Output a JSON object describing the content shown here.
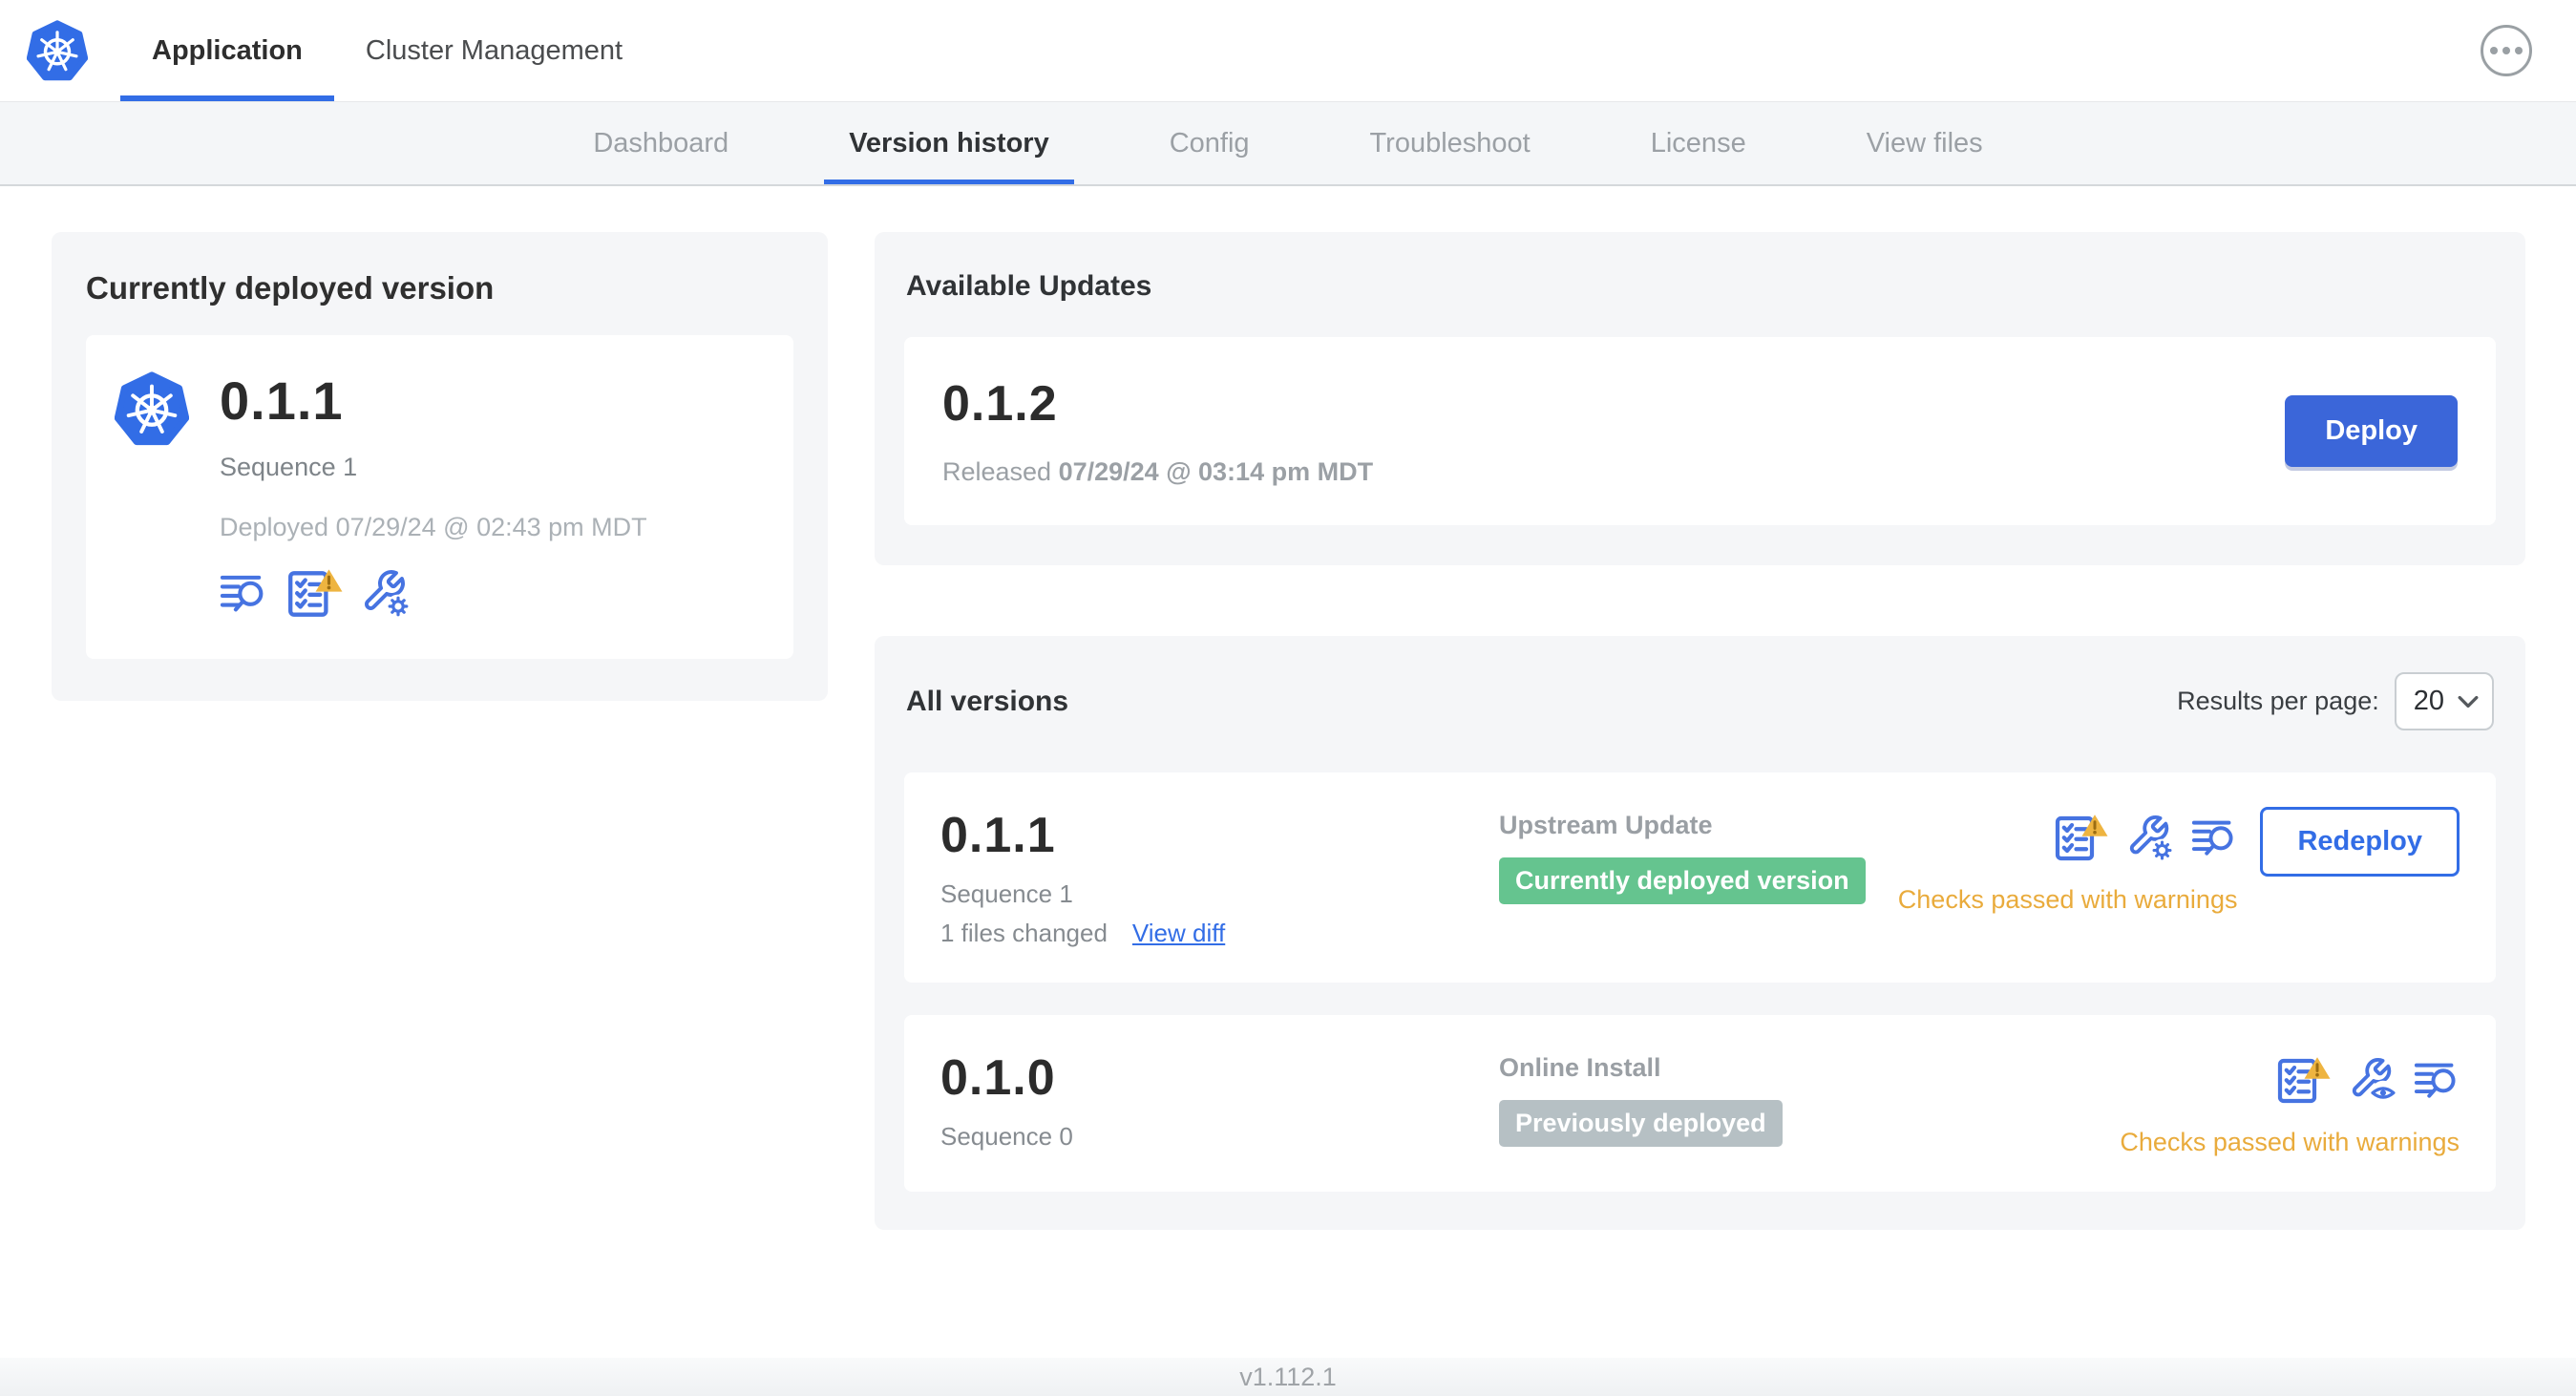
{
  "header": {
    "brand_icon": "kubernetes-logo",
    "tabs": [
      {
        "label": "Application",
        "active": true
      },
      {
        "label": "Cluster Management",
        "active": false
      }
    ],
    "menu_icon": "ellipsis-menu"
  },
  "subnav": {
    "active_tab": "Version history",
    "tabs": [
      "Dashboard",
      "Version history",
      "Config",
      "Troubleshoot",
      "License",
      "View files"
    ]
  },
  "current_version_card": {
    "title": "Currently deployed version",
    "app_icon": "kubernetes-logo",
    "version": "0.1.1",
    "sequence": "Sequence 1",
    "deployed": "Deployed 07/29/24 @ 02:43 pm MDT",
    "icons": [
      "deploy-logs-icon",
      "preflight-checks-warning-icon",
      "edit-config-icon"
    ]
  },
  "available_updates": {
    "title": "Available Updates",
    "version": "0.1.2",
    "released_label": "Released",
    "released_date": "07/29/24 @ 03:14 pm MDT",
    "deploy_button": "Deploy"
  },
  "all_versions": {
    "title": "All versions",
    "results_per_page_label": "Results per page:",
    "results_per_page_value": "20",
    "rows": [
      {
        "version": "0.1.1",
        "sequence": "Sequence 1",
        "files_changed": "1 files changed",
        "diff_link": "View diff",
        "source": "Upstream Update",
        "badge": "Currently deployed version",
        "badge_color": "green",
        "icons": [
          "preflight-checks-warning-icon",
          "edit-config-icon",
          "deploy-logs-icon"
        ],
        "status": "Checks passed with warnings",
        "action": "Redeploy"
      },
      {
        "version": "0.1.0",
        "sequence": "Sequence 0",
        "source": "Online Install",
        "badge": "Previously deployed",
        "badge_color": "gray",
        "icons": [
          "preflight-checks-warning-icon",
          "view-config-icon",
          "deploy-logs-icon"
        ],
        "status": "Checks passed with warnings"
      }
    ]
  },
  "footer": {
    "version": "v1.112.1"
  },
  "colors": {
    "accent_blue": "#326de6",
    "icon_blue": "#4673e1",
    "deploy_button_blue": "#3b66d9",
    "badge_green": "#65c48f",
    "badge_gray": "#b6c0c4",
    "warning_amber": "#e9ab3c",
    "card_background": "#f5f6f8"
  }
}
